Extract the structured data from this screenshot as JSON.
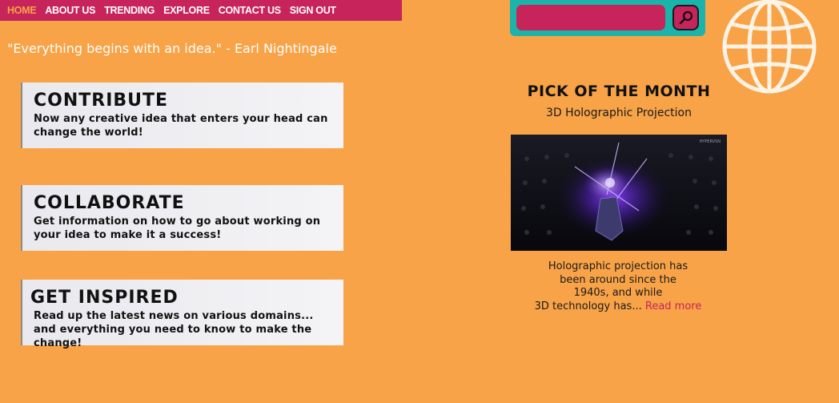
{
  "nav": {
    "items": [
      {
        "label": "HOME",
        "active": true
      },
      {
        "label": "ABOUT US"
      },
      {
        "label": "TRENDING"
      },
      {
        "label": "EXPLORE"
      },
      {
        "label": "CONTACT US"
      },
      {
        "label": "SIGN OUT"
      }
    ]
  },
  "search": {
    "placeholder": "",
    "button_icon": "magnifier-icon"
  },
  "logo_icon": "globe-icon",
  "quote": "\"Everything begins with an idea.\" - Earl Nightingale",
  "cards": [
    {
      "title": "CONTRIBUTE",
      "text": "Now any creative idea that enters your head can change the world!"
    },
    {
      "title": "COLLABORATE",
      "text": "Get information on how to go about working on your idea to make it a success!"
    },
    {
      "title": "GET INSPIRED",
      "text": "Read up the latest news on various domains... and everything you need to know to make the change!"
    }
  ],
  "pick": {
    "heading": "PICK OF THE MONTH",
    "subtitle": "3D Holographic Projection",
    "image_watermark": "HYPERVSN",
    "description_lines": [
      "Holographic projection has",
      "been around since the",
      "1940s, and while",
      "3D technology has..."
    ],
    "read_more": "Read more"
  },
  "colors": {
    "background": "#F8A348",
    "accent": "#C6245A",
    "teal": "#1BB4AA"
  }
}
